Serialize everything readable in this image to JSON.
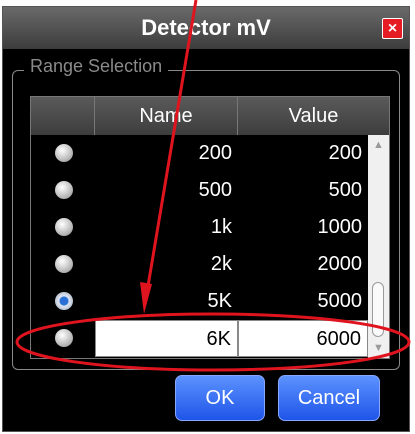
{
  "dialog": {
    "title": "Detector mV",
    "close_label": "×"
  },
  "range_selection": {
    "legend": "Range Selection",
    "columns": [
      "Name",
      "Value"
    ],
    "rows": [
      {
        "name": "200",
        "value": "200",
        "selected": false
      },
      {
        "name": "500",
        "value": "500",
        "selected": false
      },
      {
        "name": "1k",
        "value": "1000",
        "selected": false
      },
      {
        "name": "2k",
        "value": "2000",
        "selected": false
      },
      {
        "name": "5K",
        "value": "5000",
        "selected": true
      },
      {
        "name": "6K",
        "value": "6000",
        "selected": false,
        "editing": true
      }
    ]
  },
  "buttons": {
    "ok": "OK",
    "cancel": "Cancel"
  },
  "colors": {
    "annotation": "#e0141e",
    "button": "#2f68f0",
    "close": "#e51c24"
  }
}
